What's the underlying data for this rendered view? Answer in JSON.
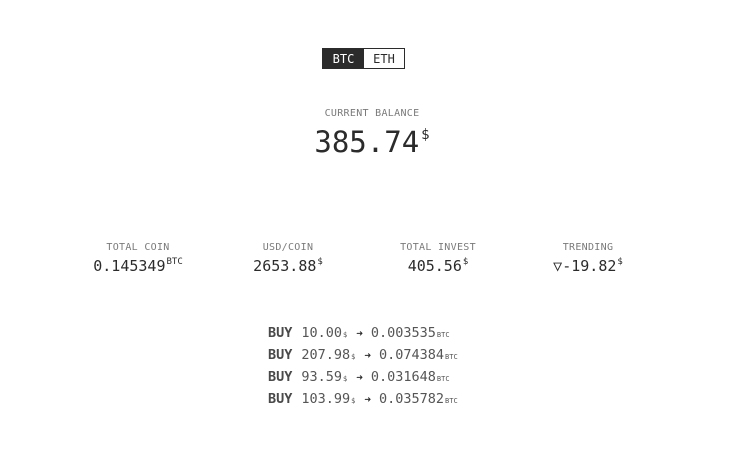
{
  "coin_toggle": {
    "options": [
      "BTC",
      "ETH"
    ],
    "selected": "BTC"
  },
  "balance": {
    "label": "CURRENT BALANCE",
    "value": "385.74",
    "unit": "$"
  },
  "stats": [
    {
      "label": "TOTAL COIN",
      "value": "0.145349",
      "unit": "BTC"
    },
    {
      "label": "USD/COIN",
      "value": "2653.88",
      "unit": "$"
    },
    {
      "label": "TOTAL INVEST",
      "value": "405.56",
      "unit": "$"
    },
    {
      "label": "TRENDING",
      "value": "▽-19.82",
      "unit": "$"
    }
  ],
  "transactions": [
    {
      "action": "BUY",
      "usd": "10.00",
      "usd_unit": "$",
      "arrow": "➜",
      "coin": "0.003535",
      "coin_unit": "BTC"
    },
    {
      "action": "BUY",
      "usd": "207.98",
      "usd_unit": "$",
      "arrow": "➜",
      "coin": "0.074384",
      "coin_unit": "BTC"
    },
    {
      "action": "BUY",
      "usd": "93.59",
      "usd_unit": "$",
      "arrow": "➜",
      "coin": "0.031648",
      "coin_unit": "BTC"
    },
    {
      "action": "BUY",
      "usd": "103.99",
      "usd_unit": "$",
      "arrow": "➜",
      "coin": "0.035782",
      "coin_unit": "BTC"
    }
  ]
}
